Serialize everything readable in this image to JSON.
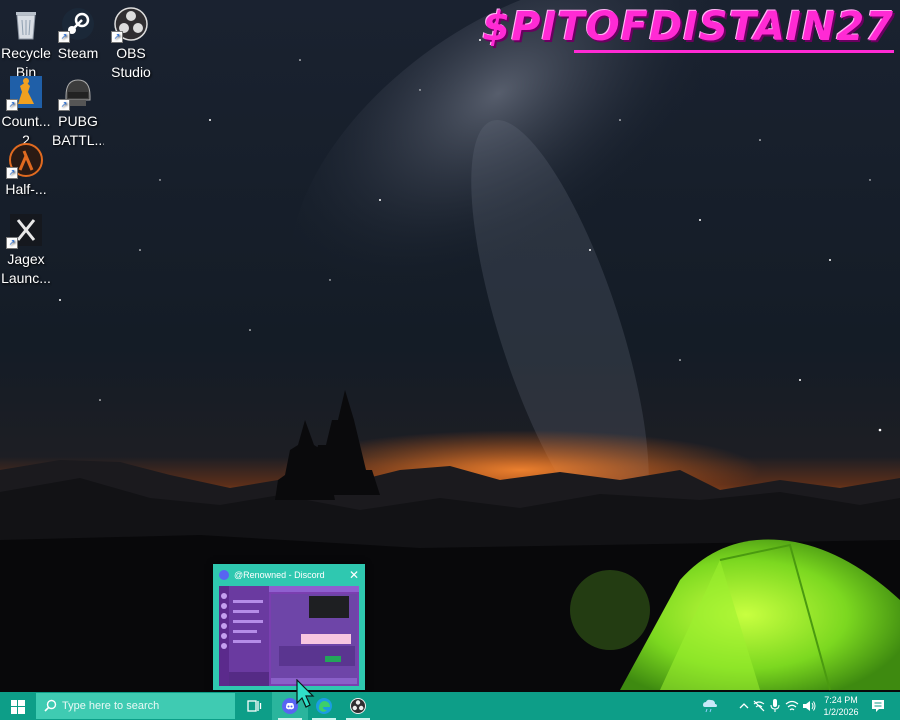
{
  "desktop": {
    "brand_text": "$PITOFDISTAIN27",
    "icons": [
      {
        "label": "Recycle Bin",
        "glyph": "recycle-bin-icon"
      },
      {
        "label": "Steam",
        "glyph": "steam-icon"
      },
      {
        "label": "OBS Studio",
        "glyph": "obs-icon"
      },
      {
        "label": "Count... 2",
        "glyph": "counter-strike-icon"
      },
      {
        "label": "PUBG BATTL...",
        "glyph": "pubg-icon"
      },
      {
        "label": "Half-...",
        "glyph": "half-life-icon"
      },
      {
        "label": "Jagex Launc...",
        "glyph": "jagex-icon"
      }
    ]
  },
  "preview": {
    "title": "@Renowned - Discord",
    "close": "✕"
  },
  "taskbar": {
    "search_placeholder": "Type here to search",
    "time": "7:24 PM",
    "date": "1/2/2026",
    "colors": {
      "taskbar": "#0d9e88",
      "search": "#3fcbb2",
      "brand": "#ff2ad4"
    }
  }
}
